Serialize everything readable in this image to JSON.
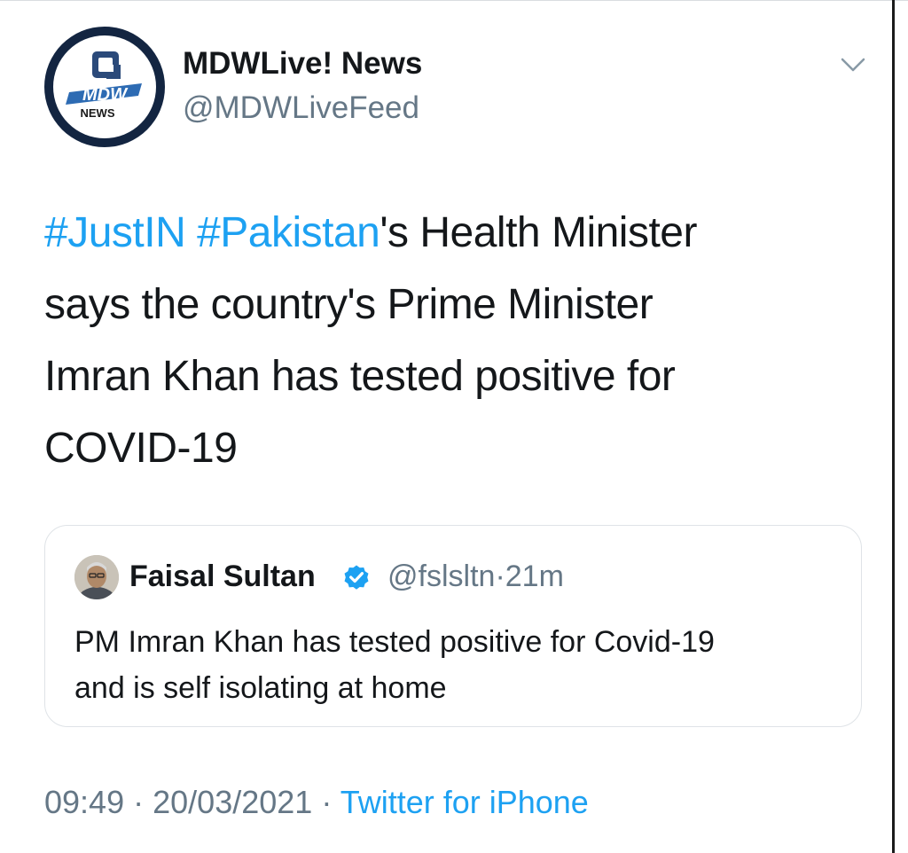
{
  "author": {
    "display_name": "MDWLive! News",
    "handle": "@MDWLiveFeed",
    "avatar_text": "NEWS",
    "avatar_logo_text": "MDW"
  },
  "tweet": {
    "hashtag_1": "#JustIN",
    "hashtag_2": "#Pakistan",
    "line_1_rest": "'s Health Minister",
    "line_2": "says the country's Prime Minister",
    "line_3": "Imran Khan has tested positive for",
    "line_4": "COVID-19"
  },
  "quoted_tweet": {
    "display_name": "Faisal Sultan",
    "handle": "@fslsltn",
    "separator": "·",
    "age": "21m",
    "verified": true,
    "text_line_1": "PM Imran Khan has tested positive for Covid-19",
    "text_line_2": "and is self isolating at home"
  },
  "footer": {
    "time": "09:49",
    "date": "20/03/2021",
    "separator": "·",
    "source": "Twitter for iPhone"
  },
  "icons": {
    "menu": "chevron-down-icon",
    "verified": "verified-badge-icon"
  },
  "colors": {
    "link_blue": "#1da1f2",
    "muted_gray": "#657786",
    "text_dark": "#14171a",
    "avatar_navy": "#132541"
  }
}
